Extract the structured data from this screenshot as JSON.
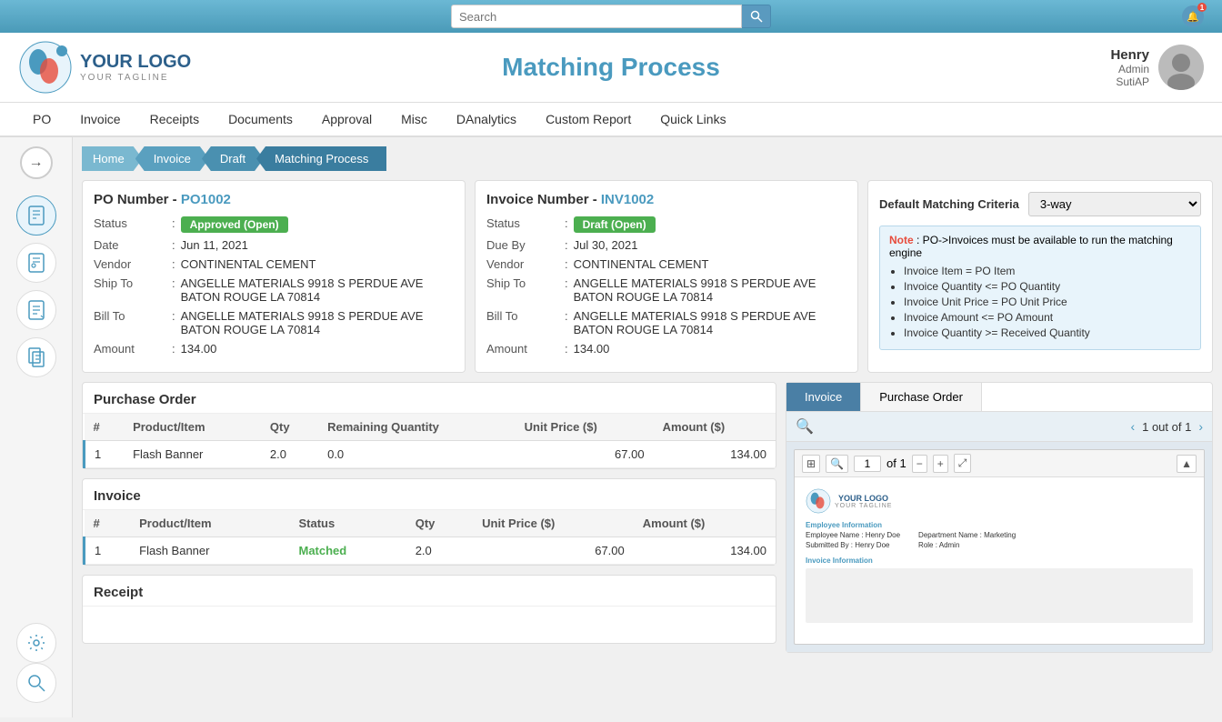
{
  "topbar": {
    "search_placeholder": "Search",
    "notification_count": "1"
  },
  "header": {
    "logo_main": "YOUR LOGO",
    "logo_tagline": "YOUR TAGLINE",
    "page_title": "Matching Process",
    "user_name": "Henry",
    "user_role": "Admin",
    "user_sub": "SutiAP"
  },
  "nav": {
    "items": [
      "PO",
      "Invoice",
      "Receipts",
      "Documents",
      "Approval",
      "Misc",
      "DAnalytics",
      "Custom Report",
      "Quick Links"
    ]
  },
  "breadcrumb": {
    "items": [
      "Home",
      "Invoice",
      "Draft",
      "Matching Process"
    ]
  },
  "po_card": {
    "title": "PO Number",
    "po_number": "PO1002",
    "status_label": "Approved (Open)",
    "date_label": "Date",
    "date_value": "Jun 11, 2021",
    "vendor_label": "Vendor",
    "vendor_value": "CONTINENTAL CEMENT",
    "ship_to_label": "Ship To",
    "ship_to_value": "ANGELLE MATERIALS 9918 S PERDUE AVE BATON ROUGE LA 70814",
    "bill_to_label": "Bill To",
    "bill_to_value": "ANGELLE MATERIALS 9918 S PERDUE AVE BATON ROUGE LA 70814",
    "amount_label": "Amount",
    "amount_value": "134.00"
  },
  "invoice_card": {
    "title": "Invoice Number",
    "inv_number": "INV1002",
    "status_label": "Draft (Open)",
    "due_by_label": "Due By",
    "due_by_value": "Jul 30, 2021",
    "vendor_label": "Vendor",
    "vendor_value": "CONTINENTAL CEMENT",
    "ship_to_label": "Ship To",
    "ship_to_value": "ANGELLE MATERIALS 9918 S PERDUE AVE BATON ROUGE LA 70814",
    "bill_to_label": "Bill To",
    "bill_to_value": "ANGELLE MATERIALS 9918 S PERDUE AVE BATON ROUGE LA 70814",
    "amount_label": "Amount",
    "amount_value": "134.00"
  },
  "criteria": {
    "label": "Default Matching Criteria",
    "value": "3-way",
    "note_prefix": "Note",
    "note_text": ": PO->Invoices must be available to run the matching engine",
    "rules": [
      "Invoice Item = PO Item",
      "Invoice Quantity <= PO Quantity",
      "Invoice Unit Price = PO Unit Price",
      "Invoice Amount <= PO Amount",
      "Invoice Quantity >= Received Quantity"
    ]
  },
  "po_table": {
    "section_title": "Purchase Order",
    "columns": [
      "#",
      "Product/Item",
      "Qty",
      "Remaining Quantity",
      "Unit Price ($)",
      "Amount ($)"
    ],
    "rows": [
      {
        "num": "1",
        "product": "Flash Banner",
        "qty": "2.0",
        "remaining": "0.0",
        "unit_price": "67.00",
        "amount": "134.00"
      }
    ]
  },
  "invoice_table": {
    "section_title": "Invoice",
    "columns": [
      "#",
      "Product/Item",
      "Status",
      "Qty",
      "Unit Price ($)",
      "Amount ($)"
    ],
    "rows": [
      {
        "num": "1",
        "product": "Flash Banner",
        "status": "Matched",
        "qty": "2.0",
        "unit_price": "67.00",
        "amount": "134.00"
      }
    ]
  },
  "receipt_table": {
    "section_title": "Receipt"
  },
  "preview": {
    "tab_invoice": "Invoice",
    "tab_po": "Purchase Order",
    "page_text": "1 out of 1",
    "page_num": "1",
    "of_text": "of 1",
    "doc_logo": "YOUR LOGO",
    "doc_tagline": "YOUR TAGLINE",
    "doc_emp_info": "Employee Information",
    "doc_emp_name": "Employee Name : Henry Doe",
    "doc_dept": "Department Name : Marketing",
    "doc_role": "Role : Admin",
    "doc_submitted": "Submitted By : Henry Doe",
    "doc_inv_info": "Invoice Information"
  }
}
